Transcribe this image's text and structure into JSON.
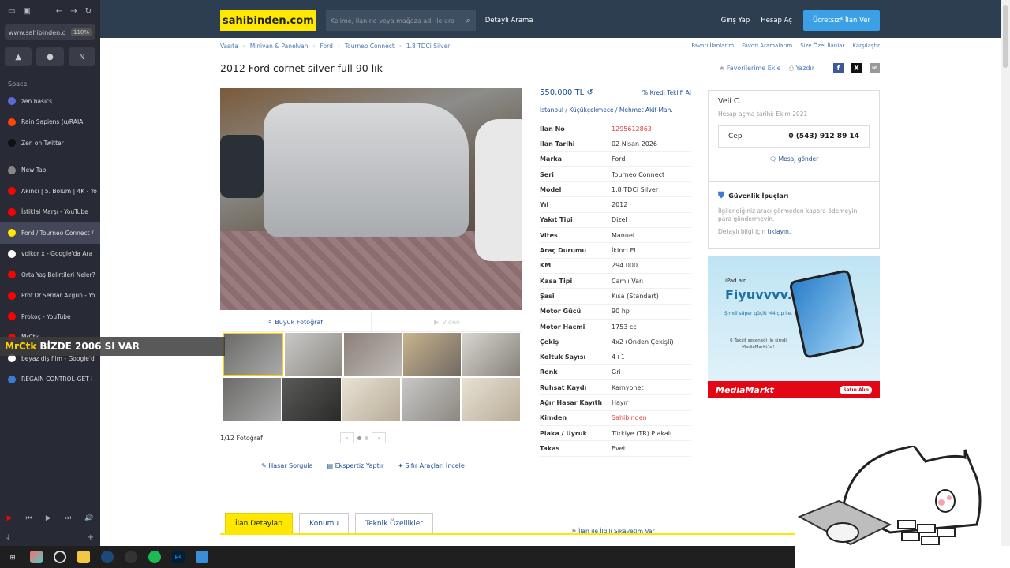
{
  "browser": {
    "url": "www.sahibinden.c",
    "zoom": "110%",
    "space_label": "Space",
    "tabs": [
      {
        "label": "zen basics",
        "color": "#5a6ad4"
      },
      {
        "label": "Rain Sapiens (u/RAIA",
        "color": "#ff4500"
      },
      {
        "label": "Zen on Twitter",
        "color": "#111111"
      },
      {
        "label": "New Tab",
        "color": "#888888"
      },
      {
        "label": "Akıncı | 5. Bölüm | 4K - Yo",
        "color": "#ff0000"
      },
      {
        "label": "İstiklal Marşı - YouTube",
        "color": "#ff0000"
      },
      {
        "label": "Ford / Tourneo Connect /",
        "color": "#ffe800"
      },
      {
        "label": "volkor x - Google'da Ara",
        "color": "#ffffff"
      },
      {
        "label": "Orta Yaş Belirtileri Neler?",
        "color": "#ff0000"
      },
      {
        "label": "Prof.Dr.Serdar Akgün - Yo",
        "color": "#ff0000"
      },
      {
        "label": "Prokoç - YouTube",
        "color": "#ff0000"
      },
      {
        "label": "MrCtk",
        "color": "#ff0000"
      },
      {
        "label": "beyaz diş film - Google'd",
        "color": "#ffffff"
      },
      {
        "label": "REGAIN CONTROL-GET I",
        "color": "#3a7bd5"
      }
    ]
  },
  "overlay": {
    "channel": "MrCtk",
    "text": "BİZDE 2006 SI VAR"
  },
  "header": {
    "logo": "sahibinden.com",
    "search_placeholder": "Kelime, ilan no veya mağaza adı ile ara",
    "detailed_search": "Detaylı Arama",
    "login": "Giriş Yap",
    "register": "Hesap Aç",
    "post_ad": "Ücretsiz* İlan Ver"
  },
  "breadcrumbs": [
    "Vasıta",
    "Minivan & Panelvan",
    "Ford",
    "Tourneo Connect",
    "1.8 TDCi Silver"
  ],
  "crumb_links": [
    "Favori İlanlarım",
    "Favori Aramalarım",
    "Size Özel İlanlar",
    "Karşılaştır"
  ],
  "listing": {
    "title": "2012 Ford cornet silver full 90 lık",
    "add_favorite": "Favorilerime Ekle",
    "print": "Yazdır",
    "big_photo": "Büyük Fotoğraf",
    "video": "Video",
    "photo_counter": "1/12 Fotoğraf",
    "services": [
      "Hasar Sorgula",
      "Ekspertiz Yaptır",
      "Sıfır Araçları İncele"
    ],
    "price": "550.000 TL",
    "credit": "Kredi Teklifi Al",
    "location": "İstanbul  /  Küçükçekmece  /  Mehmet Akif Mah.",
    "complaint": "İlan ile İlgili Şikayetim Var",
    "details": [
      {
        "k": "İlan No",
        "v": "1295612863",
        "red": true
      },
      {
        "k": "İlan Tarihi",
        "v": "02 Nisan 2026"
      },
      {
        "k": "Marka",
        "v": "Ford"
      },
      {
        "k": "Seri",
        "v": "Tourneo Connect"
      },
      {
        "k": "Model",
        "v": "1.8 TDCi Silver"
      },
      {
        "k": "Yıl",
        "v": "2012"
      },
      {
        "k": "Yakıt Tipi",
        "v": "Dizel"
      },
      {
        "k": "Vites",
        "v": "Manuel"
      },
      {
        "k": "Araç Durumu",
        "v": "İkinci El"
      },
      {
        "k": "KM",
        "v": "294.000"
      },
      {
        "k": "Kasa Tipi",
        "v": "Camlı Van"
      },
      {
        "k": "Şasi",
        "v": "Kısa (Standart)"
      },
      {
        "k": "Motor Gücü",
        "v": "90 hp"
      },
      {
        "k": "Motor Hacmi",
        "v": "1753 cc"
      },
      {
        "k": "Çekiş",
        "v": "4x2 (Önden Çekişli)"
      },
      {
        "k": "Koltuk Sayısı",
        "v": "4+1"
      },
      {
        "k": "Renk",
        "v": "Gri"
      },
      {
        "k": "Ruhsat Kaydı",
        "v": "Kamyonet"
      },
      {
        "k": "Ağır Hasar Kayıtlı",
        "v": "Hayır"
      },
      {
        "k": "Kimden",
        "v": "Sahibinden",
        "red": true
      },
      {
        "k": "Plaka / Uyruk",
        "v": "Türkiye (TR) Plakalı"
      },
      {
        "k": "Takas",
        "v": "Evet"
      }
    ]
  },
  "seller": {
    "name": "Veli C.",
    "since": "Hesap açma tarihi: Ekim 2021",
    "phone_label": "Cep",
    "phone": "0 (543) 912 89 14",
    "message": "Mesaj gönder"
  },
  "tips": {
    "title": "Güvenlik İpuçları",
    "body": "İlgilendiğiniz aracı görmeden kapora ödemeyin, para göndermeyin.",
    "more_prefix": "Detaylı bilgi için",
    "more_link": "tıklayın."
  },
  "ad": {
    "brand": "iPad air",
    "headline": "Fiyuvvvv.",
    "sub": "Şimdi süper güçlü M4 çip ile.",
    "small": "6 Taksit seçeneği ile şimdi MediaMarkt'ta!",
    "store": "MediaMarkt",
    "cta": "Satın Alın"
  },
  "tabs": [
    {
      "label": "İlan Detayları",
      "on": true
    },
    {
      "label": "Konumu"
    },
    {
      "label": "Teknik Özellikler"
    }
  ]
}
